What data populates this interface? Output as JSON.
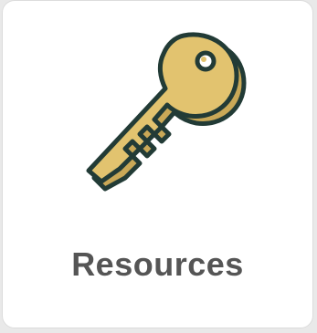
{
  "tile": {
    "label": "Resources",
    "icon": "key-icon"
  },
  "colors": {
    "key_fill": "#e2c36f",
    "key_shadow": "#c9a857",
    "key_outline": "#223b36",
    "label": "#555555",
    "tile_bg": "#ffffff",
    "page_bg": "#e9e9e9"
  }
}
